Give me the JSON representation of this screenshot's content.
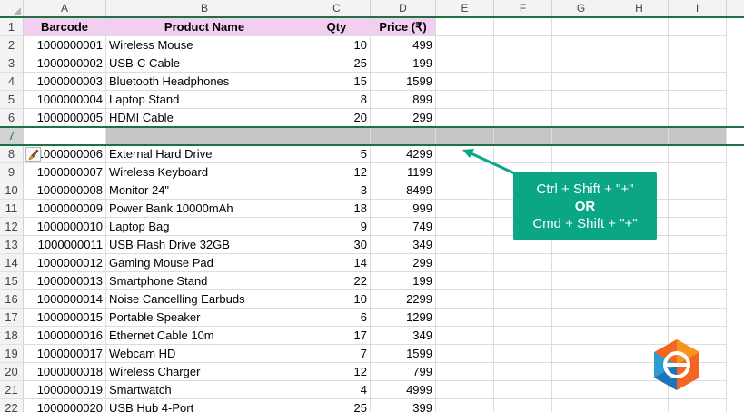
{
  "columns": [
    "A",
    "B",
    "C",
    "D",
    "E",
    "F",
    "G",
    "H",
    "I"
  ],
  "header": {
    "barcode": "Barcode",
    "product": "Product Name",
    "qty": "Qty",
    "price": "Price (₹)"
  },
  "rows": [
    {
      "num": "2",
      "barcode": "1000000001",
      "product": "Wireless Mouse",
      "qty": "10",
      "price": "499"
    },
    {
      "num": "3",
      "barcode": "1000000002",
      "product": "USB-C Cable",
      "qty": "25",
      "price": "199"
    },
    {
      "num": "4",
      "barcode": "1000000003",
      "product": "Bluetooth Headphones",
      "qty": "15",
      "price": "1599"
    },
    {
      "num": "5",
      "barcode": "1000000004",
      "product": "Laptop Stand",
      "qty": "8",
      "price": "899"
    },
    {
      "num": "6",
      "barcode": "1000000005",
      "product": "HDMI Cable",
      "qty": "20",
      "price": "299"
    },
    {
      "num": "8",
      "barcode": "1000000006",
      "product": "External Hard Drive",
      "qty": "5",
      "price": "4299"
    },
    {
      "num": "9",
      "barcode": "1000000007",
      "product": "Wireless Keyboard",
      "qty": "12",
      "price": "1199"
    },
    {
      "num": "10",
      "barcode": "1000000008",
      "product": "Monitor 24\"",
      "qty": "3",
      "price": "8499"
    },
    {
      "num": "11",
      "barcode": "1000000009",
      "product": "Power Bank 10000mAh",
      "qty": "18",
      "price": "999"
    },
    {
      "num": "12",
      "barcode": "1000000010",
      "product": "Laptop Bag",
      "qty": "9",
      "price": "749"
    },
    {
      "num": "13",
      "barcode": "1000000011",
      "product": "USB Flash Drive 32GB",
      "qty": "30",
      "price": "349"
    },
    {
      "num": "14",
      "barcode": "1000000012",
      "product": "Gaming Mouse Pad",
      "qty": "14",
      "price": "299"
    },
    {
      "num": "15",
      "barcode": "1000000013",
      "product": "Smartphone Stand",
      "qty": "22",
      "price": "199"
    },
    {
      "num": "16",
      "barcode": "1000000014",
      "product": "Noise Cancelling Earbuds",
      "qty": "10",
      "price": "2299"
    },
    {
      "num": "17",
      "barcode": "1000000015",
      "product": "Portable Speaker",
      "qty": "6",
      "price": "1299"
    },
    {
      "num": "18",
      "barcode": "1000000016",
      "product": "Ethernet Cable 10m",
      "qty": "17",
      "price": "349"
    },
    {
      "num": "19",
      "barcode": "1000000017",
      "product": "Webcam HD",
      "qty": "7",
      "price": "1599"
    },
    {
      "num": "20",
      "barcode": "1000000018",
      "product": "Wireless Charger",
      "qty": "12",
      "price": "799"
    },
    {
      "num": "21",
      "barcode": "1000000019",
      "product": "Smartwatch",
      "qty": "4",
      "price": "4999"
    },
    {
      "num": "22",
      "barcode": "1000000020",
      "product": "USB Hub 4-Port",
      "qty": "25",
      "price": "399"
    }
  ],
  "header_row_num": "1",
  "inserted_row_num": "7",
  "callout": {
    "line1": "Ctrl + Shift + \"+\"",
    "line2": "OR",
    "line3": "Cmd + Shift + \"+\""
  },
  "colors": {
    "accent": "#1e7145",
    "header_fill": "#f2cff0",
    "callout": "#0aa686",
    "selected_row": "#c6c6c6"
  },
  "icons": {
    "paste_options": "paintbrush-icon",
    "logo": "brand-logo-icon"
  }
}
